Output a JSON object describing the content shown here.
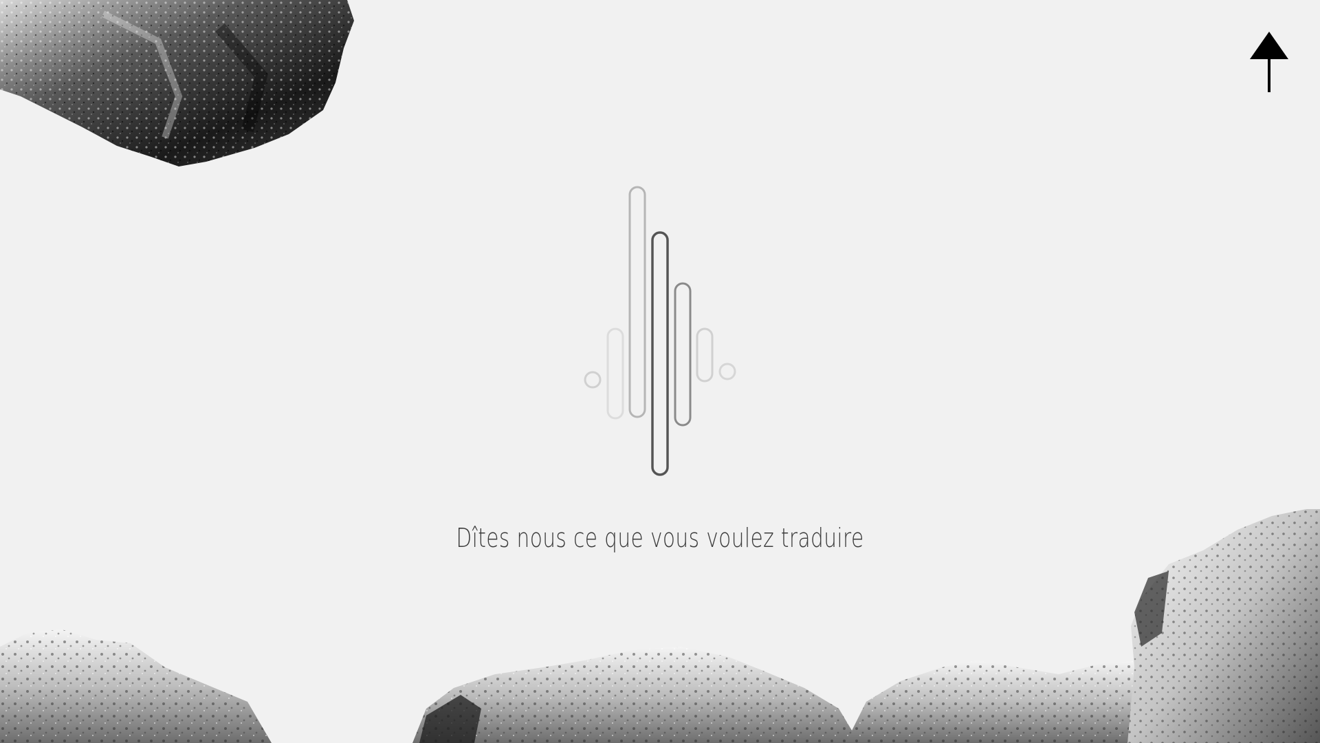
{
  "prompt": {
    "text": "Dîtes nous ce que vous voulez traduire"
  },
  "nav": {
    "up_arrow_icon": "arrow-up-icon"
  },
  "visualizer": {
    "icon": "sound-wave-icon",
    "colors": {
      "darkest": "#555555",
      "mid": "#8a8a8a",
      "light": "#b5b5b5",
      "lightest": "#d0d0d0"
    }
  },
  "decor": {
    "rock_color_dark": "#1d1d1d",
    "rock_color_light": "#e8e8e8"
  }
}
